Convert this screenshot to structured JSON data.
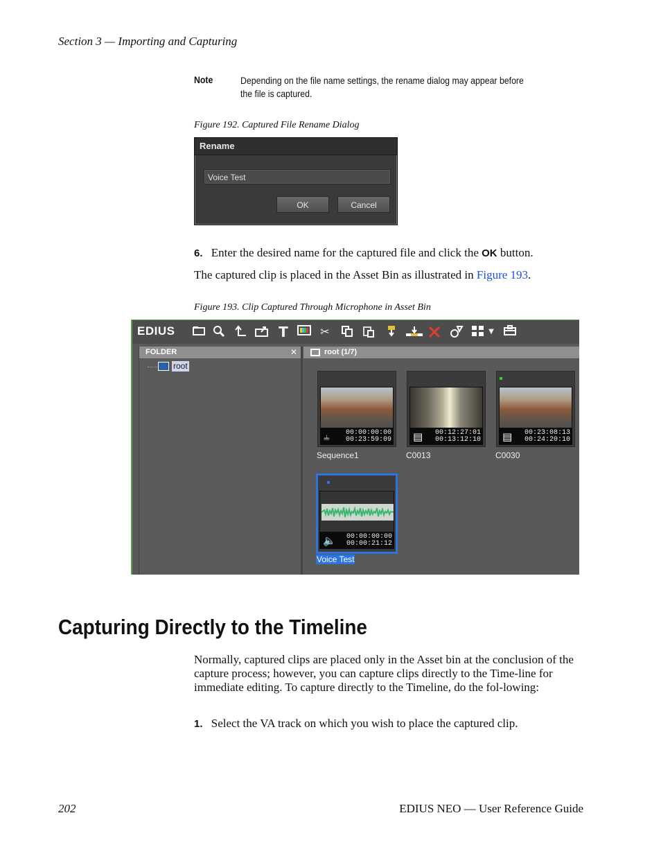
{
  "header": {
    "running_head": "Section 3 — Importing and Capturing"
  },
  "note": {
    "label": "Note",
    "text": "Depending on the file name settings, the rename dialog may appear before the file is captured."
  },
  "figure192": {
    "caption": "Figure 192. Captured File Rename Dialog",
    "dialog": {
      "title": "Rename",
      "input_value": "Voice Test",
      "ok_label": "OK",
      "cancel_label": "Cancel"
    }
  },
  "step6": {
    "number": "6.",
    "text_before": "Enter the desired name for the captured file and click the ",
    "bold": "OK",
    "text_after": " button."
  },
  "para1": {
    "text_before": "The captured clip is placed in the Asset Bin as illustrated in ",
    "link": "Figure 193",
    "text_after": "."
  },
  "figure193": {
    "caption": "Figure 193. Clip Captured Through Microphone in Asset Bin",
    "logo": "EDIUS",
    "folder_header": "FOLDER",
    "folder_close": "✕",
    "tree_item": "root",
    "clip_header": "root (1/7)",
    "colors": {
      "selection": "#2e74e0",
      "toolbar_accent": "#e23c2c",
      "wave": "#38b86c",
      "panel": "#595959"
    },
    "toolbar_icons": [
      "folder-icon",
      "search-icon",
      "up-icon",
      "export-icon",
      "title-icon",
      "color-bars-icon",
      "cut-icon",
      "copy-icon",
      "paste-icon",
      "insert-icon",
      "overwrite-icon",
      "delete-icon",
      "properties-icon",
      "view-icon",
      "dropdown-icon",
      "bin-icon"
    ],
    "clips": [
      {
        "name": "Sequence1",
        "tc_in": "00:00:00:00",
        "tc_out": "00:23:59:09",
        "type": "sequence",
        "selected": false
      },
      {
        "name": "C0013",
        "tc_in": "00:12:27:01",
        "tc_out": "00:13:12:10",
        "type": "video",
        "selected": false
      },
      {
        "name": "C0030",
        "tc_in": "00:23:08:13",
        "tc_out": "00:24:20:10",
        "type": "video",
        "selected": false
      },
      {
        "name": "Voice Test",
        "tc_in": "00:00:00:00",
        "tc_out": "00:00:21:12",
        "type": "audio",
        "selected": true
      }
    ]
  },
  "section": {
    "heading": "Capturing Directly to the Timeline",
    "para": "Normally, captured clips are placed only in the Asset bin at the conclusion of the capture process; however, you can capture clips directly to the Time-line for immediate editing. To capture directly to the Timeline, do the fol-lowing:",
    "step1_number": "1.",
    "step1_text": "Select the VA track on which you wish to place the captured clip."
  },
  "footer": {
    "page_number": "202",
    "title": "EDIUS NEO — User Reference Guide"
  }
}
